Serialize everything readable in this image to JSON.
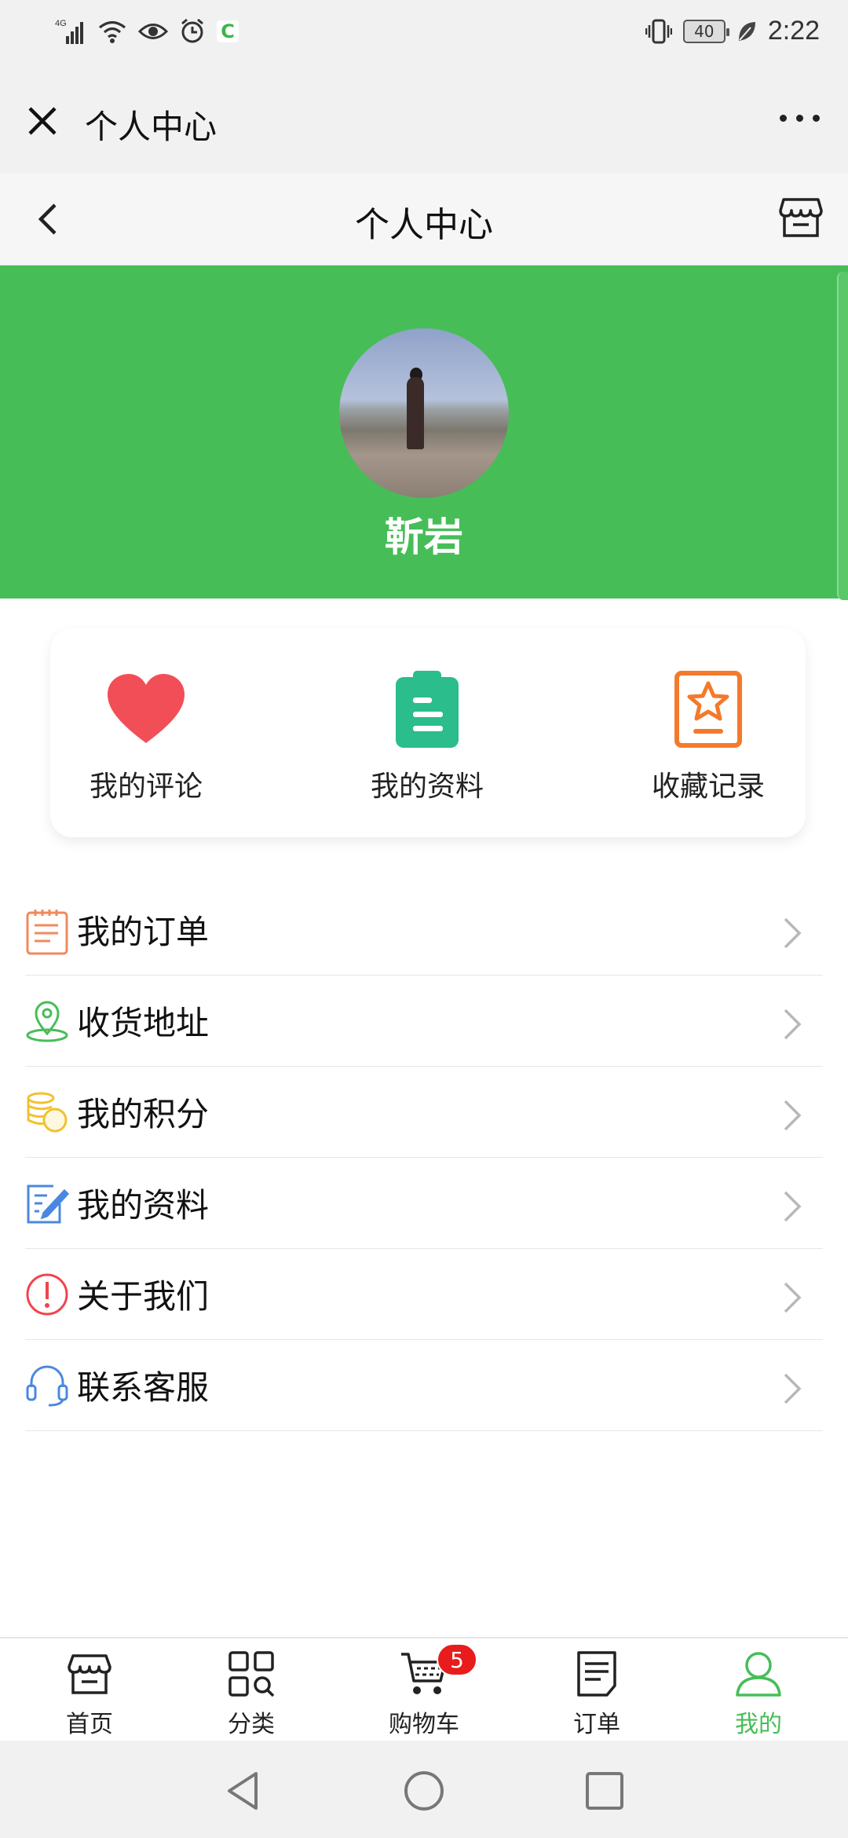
{
  "status_bar": {
    "network": "4G",
    "battery": "40",
    "time": "2:22",
    "icons": [
      "signal-icon",
      "wifi-icon",
      "eye-icon",
      "alarm-icon",
      "app-c-icon",
      "vibrate-icon",
      "battery-icon",
      "leaf-icon"
    ]
  },
  "wechat_bar": {
    "title": "个人中心"
  },
  "header": {
    "title": "个人中心"
  },
  "profile": {
    "username": "靳岩"
  },
  "quick_actions": [
    {
      "label": "我的评论",
      "icon": "heart-icon",
      "color": "#f24e57"
    },
    {
      "label": "我的资料",
      "icon": "clipboard-icon",
      "color": "#2bbd8c"
    },
    {
      "label": "收藏记录",
      "icon": "star-bookmark-icon",
      "color": "#f47a2b"
    }
  ],
  "menu": [
    {
      "label": "我的订单",
      "icon": "order-list-icon",
      "color": "#f08a5c"
    },
    {
      "label": "收货地址",
      "icon": "location-pin-icon",
      "color": "#47bd58"
    },
    {
      "label": "我的积分",
      "icon": "coins-icon",
      "color": "#f2c12e"
    },
    {
      "label": "我的资料",
      "icon": "edit-doc-icon",
      "color": "#4a88e0"
    },
    {
      "label": "关于我们",
      "icon": "alert-circle-icon",
      "color": "#f0444c"
    },
    {
      "label": "联系客服",
      "icon": "headset-icon",
      "color": "#4a88e0"
    }
  ],
  "tabs": [
    {
      "label": "首页",
      "icon": "store-icon",
      "active": false
    },
    {
      "label": "分类",
      "icon": "category-grid-icon",
      "active": false
    },
    {
      "label": "购物车",
      "icon": "cart-icon",
      "active": false,
      "badge": "5"
    },
    {
      "label": "订单",
      "icon": "order-doc-icon",
      "active": false
    },
    {
      "label": "我的",
      "icon": "user-icon",
      "active": true
    }
  ],
  "colors": {
    "primary_green": "#47bd58",
    "badge_red": "#e81c1c"
  }
}
